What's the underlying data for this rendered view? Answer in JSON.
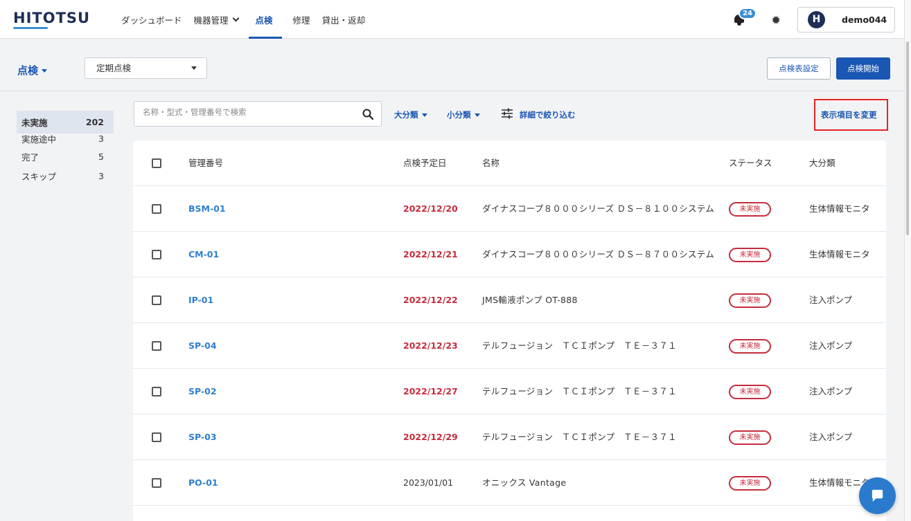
{
  "app": {
    "logo": "HITOTSU"
  },
  "nav": {
    "items": [
      {
        "label": "ダッシュボード"
      },
      {
        "label": "機器管理"
      },
      {
        "label": "点検"
      },
      {
        "label": "修理"
      },
      {
        "label": "貸出・返却"
      }
    ],
    "notification_count": "24",
    "user": {
      "avatar_letter": "H",
      "name": "demo044"
    }
  },
  "subheader": {
    "mode": "点検",
    "inspection_type": "定期点検",
    "settings_button": "点検表設定",
    "start_button": "点検開始"
  },
  "sidebar": {
    "items": [
      {
        "label": "未実施",
        "count": "202"
      },
      {
        "label": "実施途中",
        "count": "3"
      },
      {
        "label": "完了",
        "count": "5"
      },
      {
        "label": "スキップ",
        "count": "3"
      }
    ]
  },
  "filters": {
    "search_placeholder": "名称・型式・管理番号で検索",
    "category_large": "大分類",
    "category_small": "小分類",
    "detail_filter": "詳細で絞り込む",
    "change_columns": "表示項目を変更"
  },
  "table": {
    "headers": {
      "id": "管理番号",
      "date": "点検予定日",
      "name": "名称",
      "status": "ステータス",
      "category": "大分類"
    },
    "rows": [
      {
        "id": "BSM-01",
        "date": "2022/12/20",
        "overdue": true,
        "name": "ダイナスコープ８０００シリーズ ＤＳ－８１００システム",
        "status": "未実施",
        "category": "生体情報モニタ"
      },
      {
        "id": "CM-01",
        "date": "2022/12/21",
        "overdue": true,
        "name": "ダイナスコープ８０００シリーズ ＤＳ－８７００システム",
        "status": "未実施",
        "category": "生体情報モニタ"
      },
      {
        "id": "IP-01",
        "date": "2022/12/22",
        "overdue": true,
        "name": "JMS輸液ポンプ OT-888",
        "status": "未実施",
        "category": "注入ポンプ"
      },
      {
        "id": "SP-04",
        "date": "2022/12/23",
        "overdue": true,
        "name": "テルフュージョン　ＴＣＩポンプ　ＴＥ－３７１",
        "status": "未実施",
        "category": "注入ポンプ"
      },
      {
        "id": "SP-02",
        "date": "2022/12/27",
        "overdue": true,
        "name": "テルフュージョン　ＴＣＩポンプ　ＴＥ－３７１",
        "status": "未実施",
        "category": "注入ポンプ"
      },
      {
        "id": "SP-03",
        "date": "2022/12/29",
        "overdue": true,
        "name": "テルフュージョン　ＴＣＩポンプ　ＴＥ－３７１",
        "status": "未実施",
        "category": "注入ポンプ"
      },
      {
        "id": "PO-01",
        "date": "2023/01/01",
        "overdue": false,
        "name": "オニックス Vantage",
        "status": "未実施",
        "category": "生体情報モニタ"
      }
    ]
  },
  "colors": {
    "primary": "#1a56b3",
    "link": "#2d7fd0",
    "overdue": "#c62b3b",
    "highlight_box": "#e52222"
  }
}
